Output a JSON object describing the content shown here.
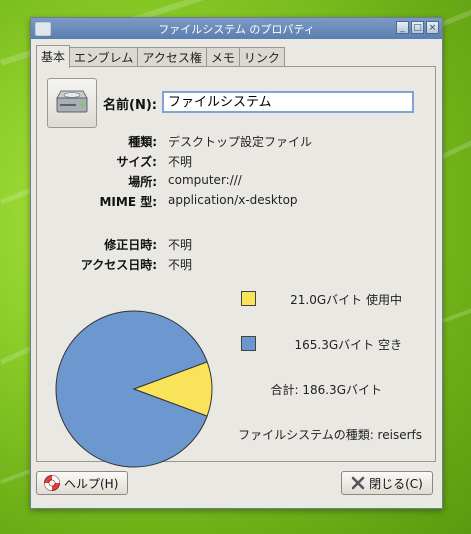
{
  "window": {
    "title": "ファイルシステム のプロパティ",
    "controls": [
      "_",
      "□",
      "×"
    ]
  },
  "tabs": [
    {
      "label": "基本",
      "active": true
    },
    {
      "label": "エンブレム",
      "active": false
    },
    {
      "label": "アクセス権",
      "active": false
    },
    {
      "label": "メモ",
      "active": false
    },
    {
      "label": "リンク",
      "active": false
    }
  ],
  "basic": {
    "icon": "harddisk-icon",
    "name_label": "名前(N):",
    "name_value": "ファイルシステム",
    "rows": [
      {
        "label": "種類:",
        "value": "デスクトップ設定ファイル"
      },
      {
        "label": "サイズ:",
        "value": "不明"
      },
      {
        "label": "場所:",
        "value": "computer:///"
      },
      {
        "label": "MIME 型:",
        "value": "application/x-desktop"
      },
      {
        "label": "修正日時:",
        "value": "不明"
      },
      {
        "label": "アクセス日時:",
        "value": "不明"
      }
    ]
  },
  "usage": {
    "used_label": "21.0Gバイト 使用中",
    "free_label": "165.3Gバイト 空き",
    "total_label": "合計: 186.3Gバイト",
    "fs_type_label": "ファイルシステムの種類: reiserfs",
    "used_color": "#f8e35a",
    "free_color": "#6d98cf",
    "used_gb": 21.0,
    "free_gb": 165.3
  },
  "buttons": {
    "help_label": "ヘルプ(H)",
    "help_icon": "lifebuoy-icon",
    "close_label": "閉じる(C)",
    "close_icon": "close-x-icon"
  }
}
